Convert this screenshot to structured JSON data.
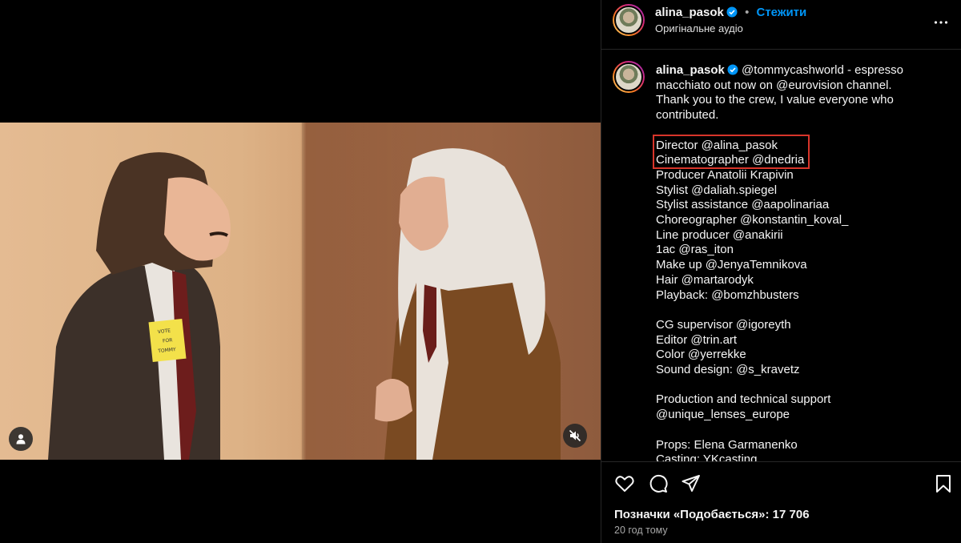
{
  "post": {
    "username": "alina_pasok",
    "separator": "•",
    "follow_label": "Стежити",
    "audio_label": "Оригінальне аудіо",
    "more_icon": "more-horizontal-icon",
    "verified_icon": "verified-badge-icon"
  },
  "video": {
    "sticky_note_lines": [
      "VOTE",
      "FOR",
      "TOMMY"
    ],
    "user_tag_icon": "user-icon",
    "mute_icon": "speaker-muted-icon"
  },
  "caption": {
    "username": "alina_pasok",
    "intro": " @tommycashworld - espresso",
    "lines": [
      "macchiato out now on @eurovision channel.",
      "Thank you to the crew, I value everyone who",
      "contributed.",
      "",
      "Director @alina_pasok",
      "Cinematographer @dnedria",
      "Producer Anatolii Krapivin",
      "Stylist @daliah.spiegel",
      "Stylist assistance @aapolinariaa",
      "Choreographer @konstantin_koval_",
      "Line producer @anakirii",
      "1ac @ras_iton",
      "Make up @JenyaTemnikova",
      "Hair @martarodyk",
      "Playback: @bomzhbusters",
      "",
      "CG supervisor @igoreyth",
      "Editor @trin.art",
      "Color @yerrekke",
      "Sound design: @s_kravetz",
      "",
      "Production and technical support",
      "@unique_lenses_europe",
      "",
      "Props: Elena Garmanenko",
      "Casting: YKcasting"
    ]
  },
  "actions": {
    "like_icon": "heart-icon",
    "comment_icon": "comment-icon",
    "share_icon": "share-icon",
    "save_icon": "bookmark-icon",
    "likes_text": "Позначки «Подобається»: 17 706",
    "time_text": "20 год тому"
  },
  "colors": {
    "accent": "#0095f6",
    "highlight_box": "#d8352a",
    "background": "#000000"
  }
}
